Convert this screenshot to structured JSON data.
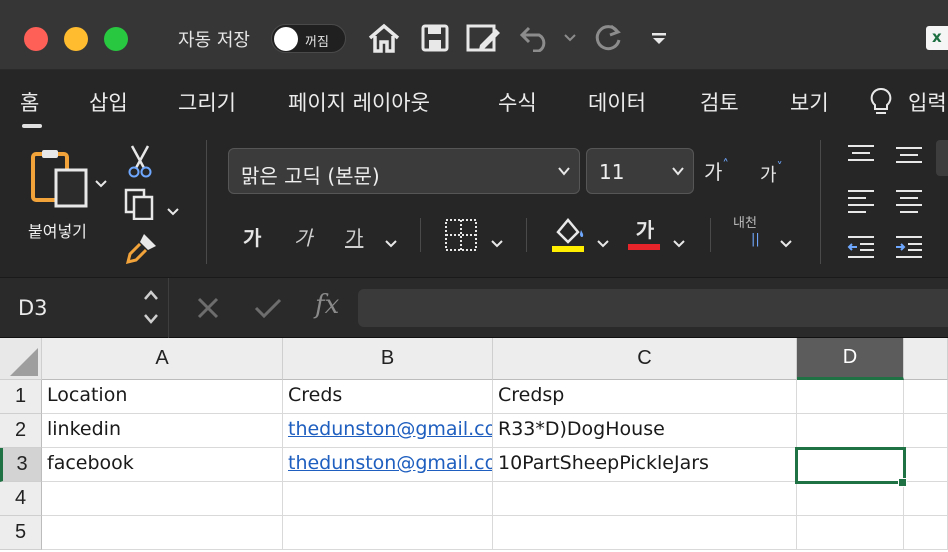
{
  "titlebar": {
    "autosave_label": "자동 저장",
    "autosave_state": "꺼짐",
    "icons": [
      "home-icon",
      "save-icon",
      "edit-icon",
      "undo-icon",
      "redo-icon",
      "customize-toolbar-icon"
    ]
  },
  "tabs": [
    {
      "label": "홈",
      "active": true
    },
    {
      "label": "삽입"
    },
    {
      "label": "그리기"
    },
    {
      "label": "페이지 레이아웃"
    },
    {
      "label": "수식"
    },
    {
      "label": "데이터"
    },
    {
      "label": "검토"
    },
    {
      "label": "보기"
    },
    {
      "label": "입력"
    }
  ],
  "ribbon": {
    "paste_label": "붙여넣기",
    "font_name": "맑은 고딕 (본문)",
    "font_size": "11",
    "grow_font": "가",
    "shrink_font": "가",
    "bold": "가",
    "italic": "가",
    "underline": "가",
    "font_color_glyph": "가",
    "wrap_text_label": "내천",
    "fill_color": "#ffee00",
    "font_color": "#e8242b"
  },
  "formula_bar": {
    "name_box": "D3",
    "fx_label": "fx",
    "content": ""
  },
  "sheet": {
    "columns": [
      "A",
      "B",
      "C",
      "D"
    ],
    "selected_column": "D",
    "rows": [
      "1",
      "2",
      "3",
      "4",
      "5"
    ],
    "selected_row": "3",
    "cells": [
      [
        "Location",
        "Creds",
        "Credsp",
        ""
      ],
      [
        "linkedin",
        "thedunston@gmail.com",
        "R33*D)DogHouse",
        ""
      ],
      [
        "facebook",
        "thedunston@gmail.com",
        "10PartSheepPickleJars",
        ""
      ],
      [
        "",
        "",
        "",
        ""
      ],
      [
        "",
        "",
        "",
        ""
      ]
    ],
    "active_cell": "D3"
  },
  "colors": {
    "accent": "#1f7244",
    "link": "#1f5fbf"
  }
}
